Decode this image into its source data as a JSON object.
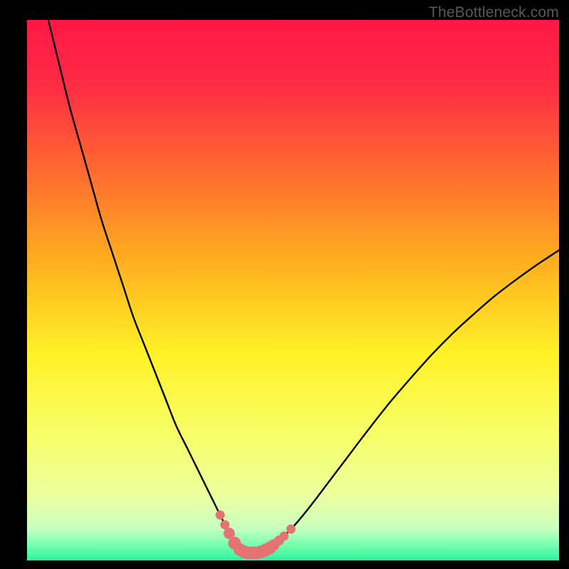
{
  "watermark": "TheBottleneck.com",
  "colors": {
    "frame": "#000000",
    "curve": "#000000",
    "marker_fill": "#e57373",
    "marker_stroke": "#c75a5a",
    "gradient_stops": [
      {
        "offset": 0.0,
        "color": "#ff1846"
      },
      {
        "offset": 0.12,
        "color": "#ff2b44"
      },
      {
        "offset": 0.28,
        "color": "#ff6a30"
      },
      {
        "offset": 0.45,
        "color": "#ffb01e"
      },
      {
        "offset": 0.62,
        "color": "#fff227"
      },
      {
        "offset": 0.78,
        "color": "#f6ff6c"
      },
      {
        "offset": 0.88,
        "color": "#ecff9f"
      },
      {
        "offset": 0.94,
        "color": "#c8ffc0"
      },
      {
        "offset": 0.97,
        "color": "#7affb0"
      },
      {
        "offset": 1.0,
        "color": "#28f59a"
      }
    ]
  },
  "chart_data": {
    "type": "line",
    "title": "",
    "xlabel": "",
    "ylabel": "",
    "xlim": [
      0,
      100
    ],
    "ylim": [
      0,
      100
    ],
    "grid": false,
    "series": [
      {
        "name": "bottleneck-curve",
        "x": [
          4,
          6,
          8,
          10,
          12,
          14,
          16,
          18,
          20,
          22,
          24,
          26,
          28,
          30,
          31,
          32,
          33,
          34,
          35,
          36,
          37,
          38,
          38.5,
          39,
          39.5,
          40,
          41,
          42,
          43,
          44,
          45,
          46,
          47,
          48,
          50,
          52,
          54,
          56,
          58,
          60,
          64,
          68,
          72,
          76,
          80,
          84,
          88,
          92,
          96,
          100
        ],
        "y": [
          100,
          92,
          84,
          77,
          70,
          63,
          57,
          51,
          45,
          40,
          35,
          30,
          25,
          21,
          19,
          17,
          15,
          13,
          11,
          9,
          7,
          5,
          4,
          3,
          2.5,
          2,
          1.6,
          1.4,
          1.4,
          1.6,
          2,
          2.6,
          3.3,
          4.2,
          6.2,
          8.5,
          11,
          13.6,
          16.2,
          18.8,
          24,
          29,
          33.6,
          38,
          42,
          45.6,
          49,
          52,
          54.8,
          57.4
        ]
      }
    ],
    "markers": {
      "name": "highlight-points",
      "x": [
        36.3,
        37.2,
        38.0,
        39.0,
        40.0,
        40.8,
        41.6,
        42.4,
        43.2,
        44.0,
        44.8,
        45.6,
        46.4,
        47.4,
        48.3,
        49.6
      ],
      "y": [
        8.4,
        6.6,
        5.0,
        3.2,
        2.0,
        1.6,
        1.4,
        1.4,
        1.4,
        1.6,
        1.9,
        2.3,
        2.9,
        3.7,
        4.5,
        5.8
      ],
      "r": [
        6.5,
        6.5,
        8,
        9,
        9,
        9,
        9,
        9,
        9,
        9,
        9,
        9,
        8,
        7,
        6.5,
        6.5
      ]
    }
  }
}
